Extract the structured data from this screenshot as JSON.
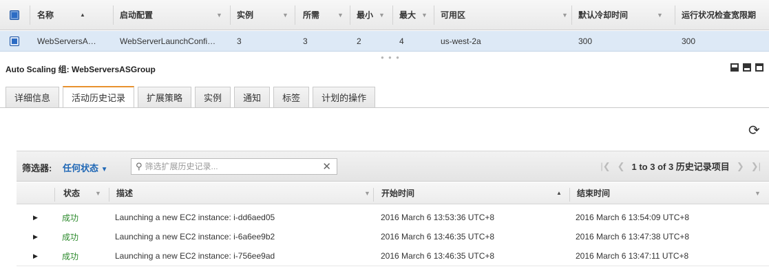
{
  "asg_table": {
    "columns": [
      "名称",
      "启动配置",
      "实例",
      "所需",
      "最小",
      "最大",
      "可用区",
      "默认冷却时间",
      "运行状况检查宽限期"
    ],
    "row": {
      "name": "WebServersA…",
      "launch_config": "WebServerLaunchConfi…",
      "instances": "3",
      "desired": "3",
      "min": "2",
      "max": "4",
      "az": "us-west-2a",
      "cooldown": "300",
      "grace": "300"
    }
  },
  "detail": {
    "title": "Auto Scaling 组: WebServersASGroup",
    "tabs": [
      "详细信息",
      "活动历史记录",
      "扩展策略",
      "实例",
      "通知",
      "标签",
      "计划的操作"
    ],
    "active_tab": 1
  },
  "filter": {
    "label": "筛选器:",
    "value": "任何状态",
    "search_placeholder": "筛选扩展历史记录...",
    "pagination": "1 to 3 of 3 历史记录项目"
  },
  "history": {
    "columns": [
      "状态",
      "描述",
      "开始时间",
      "结束时间"
    ],
    "rows": [
      {
        "status": "成功",
        "description": "Launching a new EC2 instance: i-dd6aed05",
        "start": "2016 March 6 13:53:36 UTC+8",
        "end": "2016 March 6 13:54:09 UTC+8"
      },
      {
        "status": "成功",
        "description": "Launching a new EC2 instance: i-6a6ee9b2",
        "start": "2016 March 6 13:46:35 UTC+8",
        "end": "2016 March 6 13:47:38 UTC+8"
      },
      {
        "status": "成功",
        "description": "Launching a new EC2 instance: i-756ee9ad",
        "start": "2016 March 6 13:46:35 UTC+8",
        "end": "2016 March 6 13:47:11 UTC+8"
      }
    ]
  },
  "icons": {
    "refresh": "refresh-icon",
    "search": "search-icon",
    "clear": "clear-icon",
    "expand": "expand-triangle-icon",
    "first": "first-page-icon",
    "prev": "prev-page-icon",
    "next": "next-page-icon",
    "last": "last-page-icon"
  },
  "colors": {
    "accent_tab": "#e8912d",
    "link_blue": "#1f67b5",
    "success_green": "#2d8a2d",
    "selected_row": "#dde9f6"
  }
}
